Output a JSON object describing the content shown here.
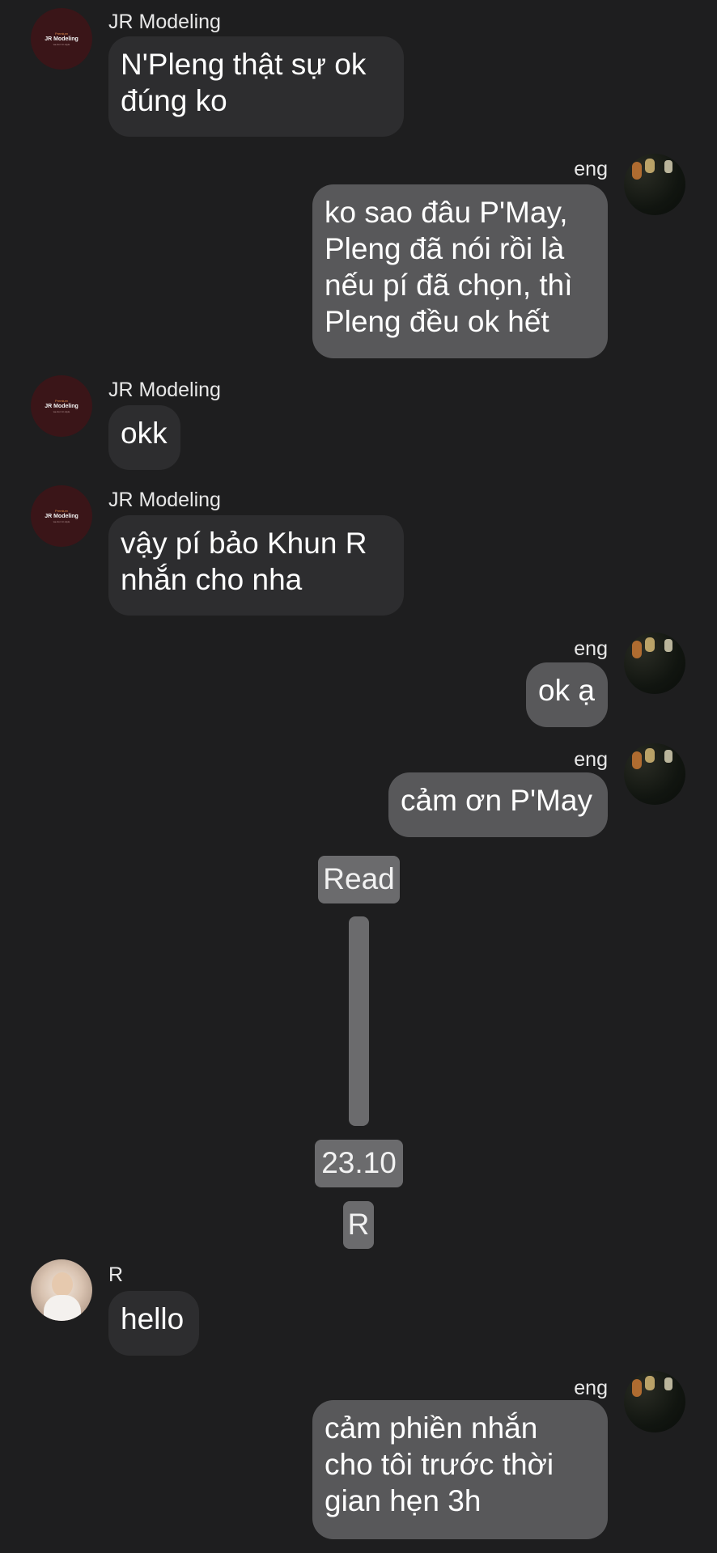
{
  "messages": [
    {
      "sender": "JR Modeling",
      "avatar": "jr-modeling-logo",
      "lines": [
        "N'Pleng thật sự ok",
        "đúng ko"
      ],
      "direction": "in"
    },
    {
      "sender": "eng",
      "avatar": "eng-avatar",
      "lines": [
        "ko sao đâu P'May,",
        "Pleng đã nói rồi là",
        "nếu pí đã chọn, thì",
        "Pleng đều ok hết"
      ],
      "direction": "out"
    },
    {
      "sender": "JR Modeling",
      "avatar": "jr-modeling-logo",
      "lines": [
        "okk"
      ],
      "direction": "in"
    },
    {
      "sender": "JR Modeling",
      "avatar": "jr-modeling-logo",
      "lines": [
        "vậy pí bảo Khun R",
        "nhắn cho nha"
      ],
      "direction": "in"
    },
    {
      "sender": "eng",
      "avatar": "eng-avatar",
      "lines": [
        "ok ạ"
      ],
      "direction": "out"
    },
    {
      "sender": "eng",
      "avatar": "eng-avatar",
      "lines": [
        "cảm ơn P'May"
      ],
      "direction": "out"
    },
    {
      "sender": "R",
      "avatar": "r-avatar",
      "lines": [
        "hello"
      ],
      "direction": "in"
    },
    {
      "sender": "eng",
      "avatar": "eng-avatar",
      "lines": [
        "cảm phiền nhắn",
        "cho tôi trước thời",
        "gian hẹn 3h"
      ],
      "direction": "out"
    }
  ],
  "avatar_logo": {
    "small_top": "Premium",
    "brand": "JR Modeling",
    "small_bottom": "we do it in style"
  },
  "system": {
    "read_label": "Read",
    "date_label": "23.10",
    "name_tag": "R"
  },
  "colors": {
    "background": "#1e1e1f",
    "incoming_bubble": "#2d2d2f",
    "outgoing_bubble": "#58585a",
    "system_chip": "#6b6b6d"
  }
}
